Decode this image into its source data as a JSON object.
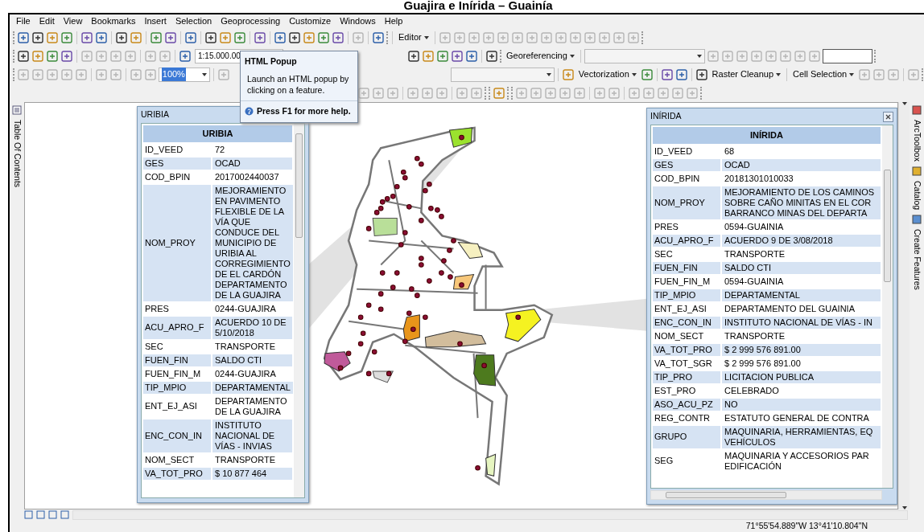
{
  "title": "Guajira e Inírida – Guainía",
  "menu": [
    "File",
    "Edit",
    "View",
    "Bookmarks",
    "Insert",
    "Selection",
    "Geoprocessing",
    "Customize",
    "Windows",
    "Help"
  ],
  "toolbars": {
    "editor": "Editor",
    "scale": "1:15.000.00",
    "georeferencing": "Georeferencing",
    "zoom_percent": "100%",
    "vectorization": "Vectorization",
    "raster_cleanup": "Raster Cleanup",
    "cell_selection": "Cell Selection"
  },
  "tooltip": {
    "title": "HTML Popup",
    "text": "Launch an HTML popup by clicking on a feature.",
    "help": "Press F1 for more help."
  },
  "left_dock": [
    "Table Of Contents"
  ],
  "right_dock": [
    "ArcToolbox",
    "Catalog",
    "Create Features"
  ],
  "popups": [
    {
      "title": "URIBIA",
      "header": "URIBIA",
      "rows": [
        {
          "field": "ID_VEED",
          "value": "72"
        },
        {
          "field": "GES",
          "value": "OCAD"
        },
        {
          "field": "COD_BPIN",
          "value": "2017002440037"
        },
        {
          "field": "NOM_PROY",
          "value": "MEJORAMIENTO\nEN PAVIMENTO\nFLEXIBLE DE LA\nVÍA QUE\nCONDUCE DEL\nMUNICIPIO DE\nURIBIA AL\nCORREGIMIENTO\nDE EL CARDÓN\nDEPARTAMENTO\nDE LA GUAJIRA"
        },
        {
          "field": "PRES",
          "value": "0244-GUAJIRA"
        },
        {
          "field": "ACU_APRO_F",
          "value": "ACUERDO 10 DE\n5/10/2018"
        },
        {
          "field": "SEC",
          "value": "TRANSPORTE"
        },
        {
          "field": "FUEN_FIN",
          "value": "SALDO CTI"
        },
        {
          "field": "FUEN_FIN_M",
          "value": "0244-GUAJIRA"
        },
        {
          "field": "TIP_MPIO",
          "value": "DEPARTAMENTAL"
        },
        {
          "field": "ENT_EJ_ASI",
          "value": "DEPARTAMENTO\nDE LA GUAJIRA"
        },
        {
          "field": "ENC_CON_IN",
          "value": "INSTITUTO\nNACIONAL DE\nVÍAS - INVIAS"
        },
        {
          "field": "NOM_SECT",
          "value": "TRANSPORTE"
        },
        {
          "field": "VA_TOT_PRO",
          "value": "$ 10 877 464"
        }
      ]
    },
    {
      "title": "INÍRIDA",
      "header": "INÍRIDA",
      "closable": true,
      "rows": [
        {
          "field": "ID_VEED",
          "value": "68"
        },
        {
          "field": "GES",
          "value": "OCAD"
        },
        {
          "field": "COD_BPIN",
          "value": "20181301010033"
        },
        {
          "field": "NOM_PROY",
          "value": "MEJORAMIENTO DE LOS CAMINOS\nSOBRE CAÑO MINITAS EN EL COR\nBARRANCO MINAS DEL DEPARTA"
        },
        {
          "field": "PRES",
          "value": "0594-GUAINIA"
        },
        {
          "field": "ACU_APRO_F",
          "value": "ACUERDO 9 DE 3/08/2018"
        },
        {
          "field": "SEC",
          "value": "TRANSPORTE"
        },
        {
          "field": "FUEN_FIN",
          "value": "SALDO CTI"
        },
        {
          "field": "FUEN_FIN_M",
          "value": "0594-GUAINIA"
        },
        {
          "field": "TIP_MPIO",
          "value": "DEPARTAMENTAL"
        },
        {
          "field": "ENT_EJ_ASI",
          "value": "DEPARTAMENTO DEL GUAINIA"
        },
        {
          "field": "ENC_CON_IN",
          "value": "INSTITUTO NACIONAL DE VÍAS - IN"
        },
        {
          "field": "NOM_SECT",
          "value": "TRANSPORTE"
        },
        {
          "field": "VA_TOT_PRO",
          "value": "$ 2 999 576 891.00"
        },
        {
          "field": "VA_TOT_SGR",
          "value": "$ 2 999 576 891.00"
        },
        {
          "field": "TIP_PRO",
          "value": "LICITACION PUBLICA"
        },
        {
          "field": "EST_PRO",
          "value": "CELEBRADO"
        },
        {
          "field": "ASO_ACU_PZ",
          "value": "NO"
        },
        {
          "field": "REG_CONTR",
          "value": "ESTATUTO GENERAL DE CONTRA"
        },
        {
          "field": "GRUPO",
          "value": "MAQUINARIA, HERRAMIENTAS, EQ\nVEHÍCULOS"
        },
        {
          "field": "SEG",
          "value": "MAQUINARIA Y ACCESORIOS PAR\nEDIFICACIÓN"
        }
      ]
    }
  ],
  "status_bar": {
    "coordinates": "71°55'54.889\"W  13°41'10.804\"N"
  }
}
